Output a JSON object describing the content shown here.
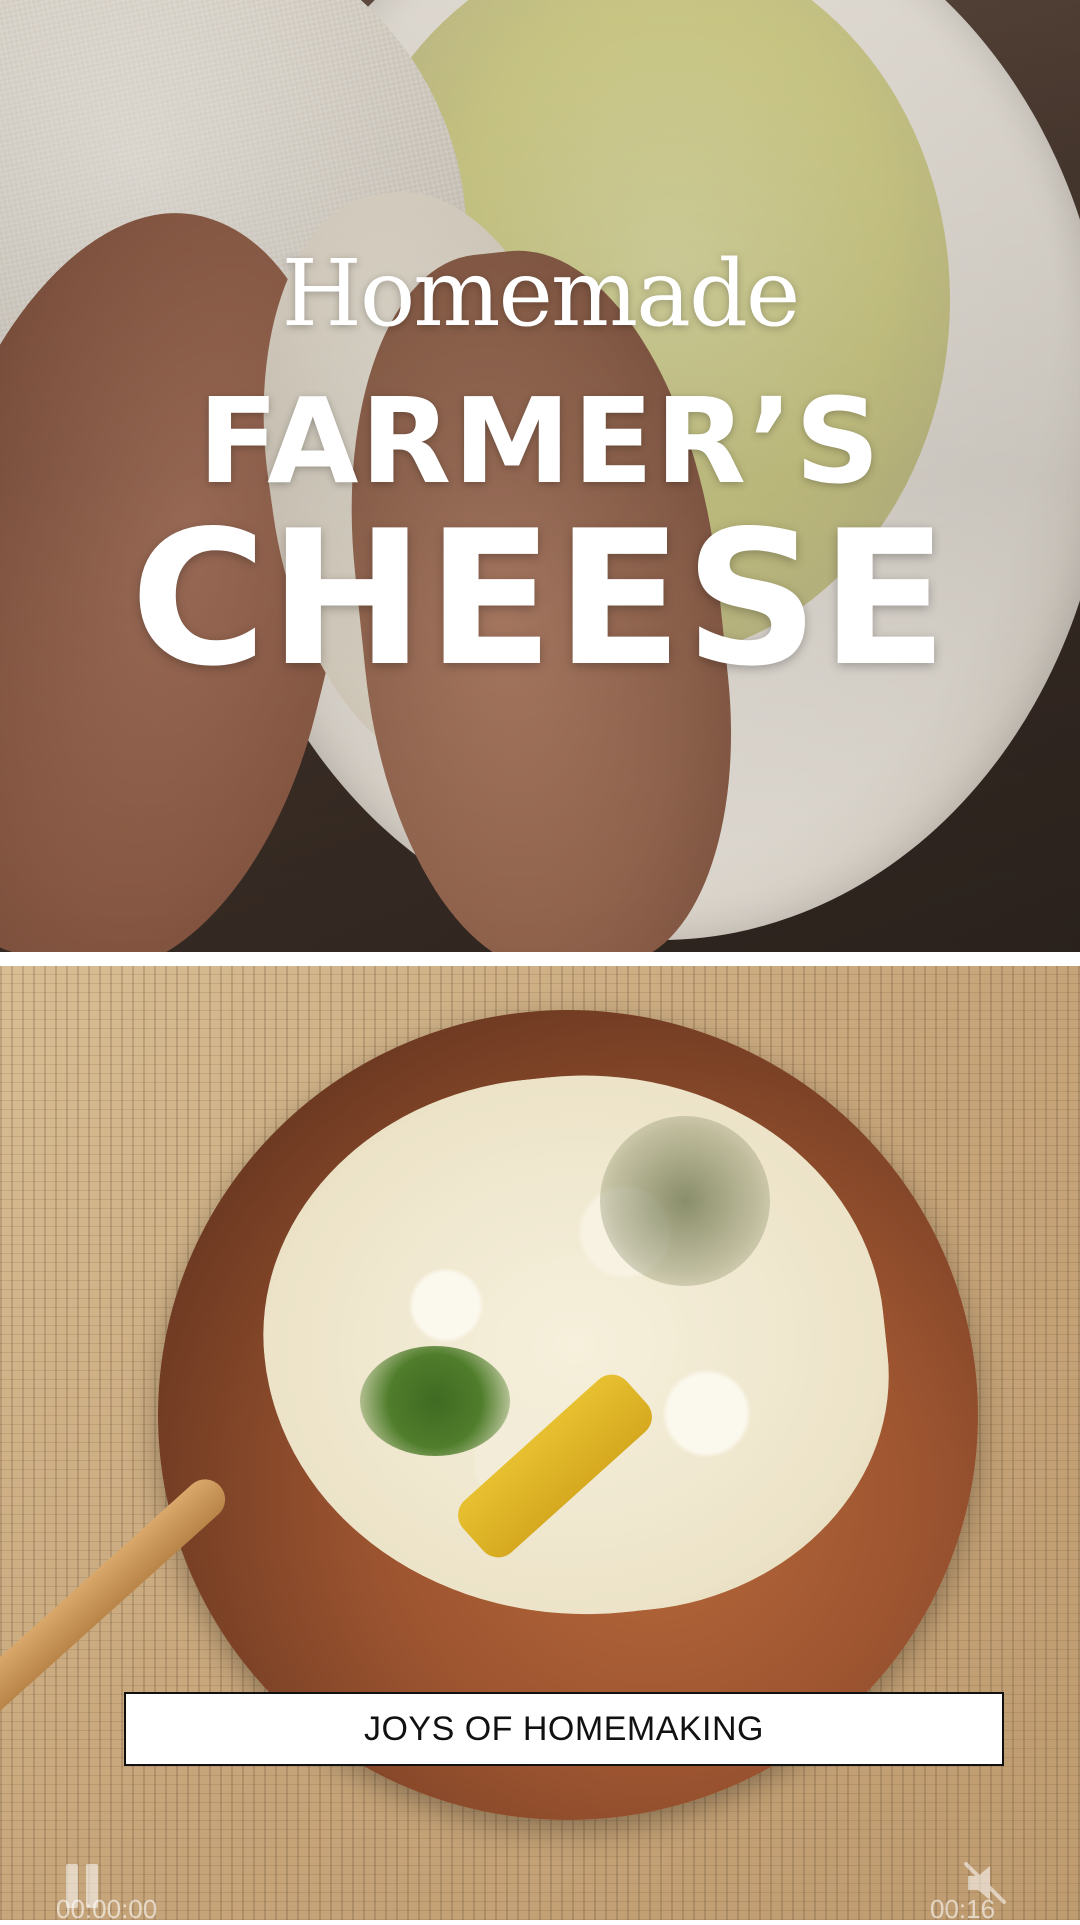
{
  "title": {
    "line1": "Homemade",
    "line2": "FARMER’S",
    "line3": "CHEESE"
  },
  "brand": {
    "label": "JOYS OF HOMEMAKING"
  },
  "player": {
    "elapsed": "00:00:00",
    "total": "00:16",
    "pause_icon": "pause-icon",
    "mute_icon": "muted-speaker-icon"
  },
  "colors": {
    "title_text": "#ffffff",
    "brand_box_bg": "#ffffff",
    "brand_box_border": "#111111"
  }
}
